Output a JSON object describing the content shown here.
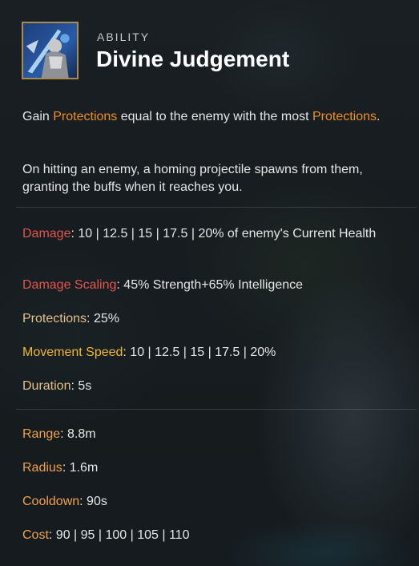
{
  "header": {
    "kind": "ABILITY",
    "title": "Divine Judgement"
  },
  "description": {
    "p1": {
      "a": "Gain ",
      "hl1": "Protections",
      "b": " equal to the enemy with the most ",
      "hl2": "Protections",
      "c": "."
    },
    "p2": "On hitting an enemy, a homing projectile spawns from them, granting the buffs when it reaches you."
  },
  "stats": [
    {
      "label": "Damage",
      "value": ": 10 | 12.5 | 15 | 17.5 | 20% of enemy's Current Health"
    },
    {
      "label": "Damage Scaling",
      "value": ": 45% Strength+65% Intelligence"
    },
    {
      "label": "Protections",
      "value": ": 25%"
    },
    {
      "label": "Movement Speed",
      "value": ": 10 | 12.5 | 15 | 17.5 | 20%"
    },
    {
      "label": "Duration",
      "value": ": 5s"
    }
  ],
  "details": [
    {
      "label": "Range",
      "value": ": 8.8m"
    },
    {
      "label": "Radius",
      "value": ": 1.6m"
    },
    {
      "label": "Cooldown",
      "value": ": 90s"
    },
    {
      "label": "Cost",
      "value": ": 90 | 95 | 100 | 105 | 110"
    }
  ],
  "icons": {
    "ability": "ability-portrait-icon"
  },
  "colors": {
    "highlight": "#f0901e",
    "damage": "#e4554b",
    "protections": "#e7c08c",
    "movement_speed": "#f0b82e",
    "detail": "#f0a14a",
    "frame": "#a98c4e"
  }
}
